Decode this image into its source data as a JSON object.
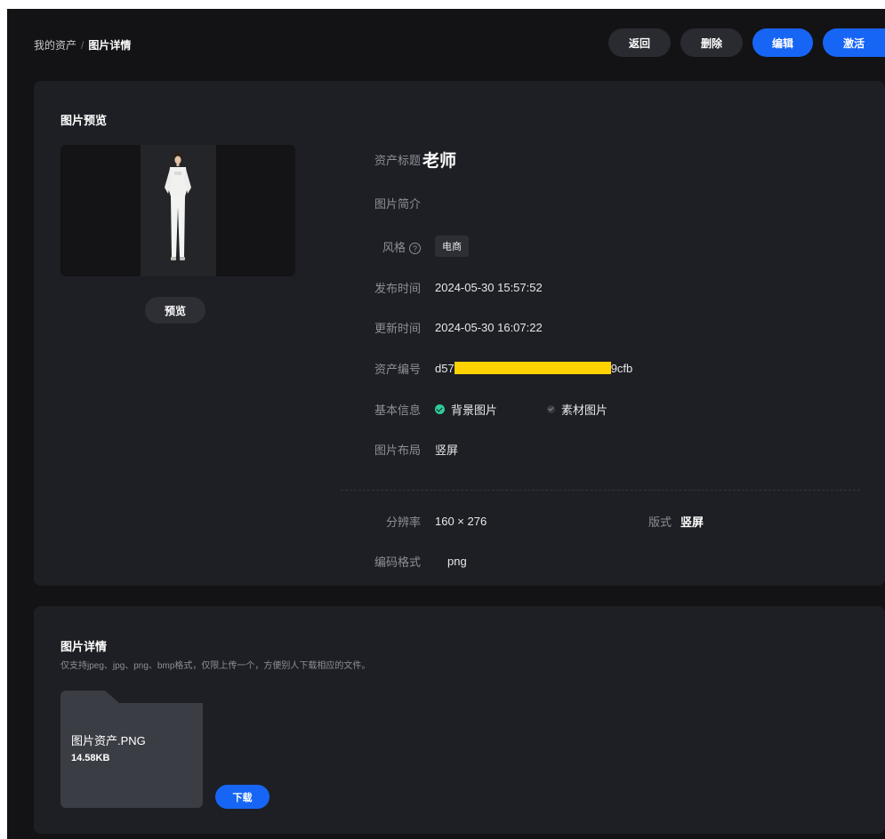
{
  "breadcrumb": {
    "parent": "我的资产",
    "separator": "/",
    "current": "图片详情"
  },
  "actions": {
    "back": "返回",
    "delete": "删除",
    "edit": "编辑",
    "activate": "激活"
  },
  "preview": {
    "title": "图片预览",
    "preview_button": "预览"
  },
  "info": {
    "title_label": "资产标题",
    "title_value": "老师",
    "intro_label": "图片简介",
    "intro_value": "",
    "style_label": "风格",
    "style_help_icon": "question-circle-icon",
    "style_tag": "电商",
    "publish_label": "发布时间",
    "publish_value": "2024-05-30 15:57:52",
    "update_label": "更新时间",
    "update_value": "2024-05-30 16:07:22",
    "id_label": "资产编号",
    "id_prefix": "d57",
    "id_suffix": "9cfb",
    "basic_label": "基本信息",
    "basic_options": [
      {
        "label": "背景图片",
        "checked": true
      },
      {
        "label": "素材图片",
        "checked": false
      }
    ],
    "layout_label": "图片布局",
    "layout_value": "竖屏",
    "resolution_label": "分辨率",
    "resolution_value": "160 × 276",
    "format_label": "版式",
    "format_value": "竖屏",
    "encoding_label": "编码格式",
    "encoding_value": "png"
  },
  "detail": {
    "title": "图片详情",
    "hint": "仅支持jpeg、jpg、png、bmp格式，仅限上传一个，方便别人下载相应的文件。",
    "file_name": "图片资产.PNG",
    "file_size": "14.58KB",
    "download": "下载"
  },
  "colors": {
    "background": "#131316",
    "panel": "#1e1f24",
    "accent": "#1765f5",
    "success": "#2ecc9a",
    "redaction": "#ffd200"
  }
}
